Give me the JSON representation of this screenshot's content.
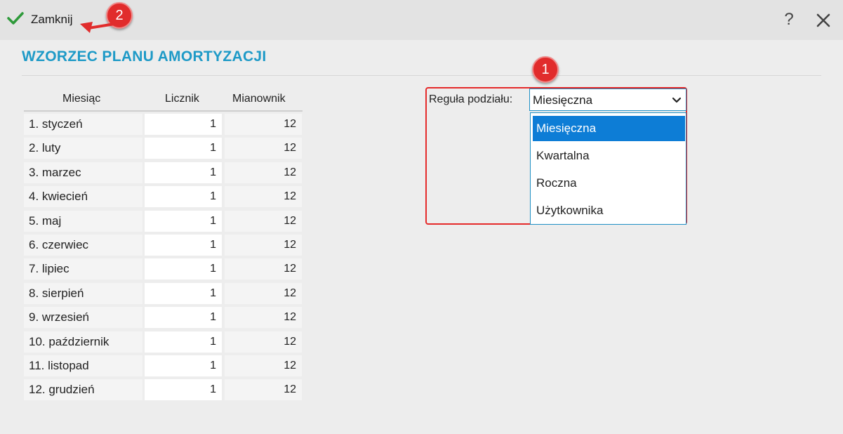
{
  "toolbar": {
    "close_label": "Zamknij",
    "help_label": "?"
  },
  "title": "WZORZEC PLANU AMORTYZACJI",
  "table": {
    "headers": [
      "Miesiąc",
      "Licznik",
      "Mianownik"
    ],
    "rows": [
      {
        "month": "1. styczeń",
        "licznik": "1",
        "mianownik": "12"
      },
      {
        "month": "2. luty",
        "licznik": "1",
        "mianownik": "12"
      },
      {
        "month": "3. marzec",
        "licznik": "1",
        "mianownik": "12"
      },
      {
        "month": "4. kwiecień",
        "licznik": "1",
        "mianownik": "12"
      },
      {
        "month": "5. maj",
        "licznik": "1",
        "mianownik": "12"
      },
      {
        "month": "6. czerwiec",
        "licznik": "1",
        "mianownik": "12"
      },
      {
        "month": "7. lipiec",
        "licznik": "1",
        "mianownik": "12"
      },
      {
        "month": "8. sierpień",
        "licznik": "1",
        "mianownik": "12"
      },
      {
        "month": "9. wrzesień",
        "licznik": "1",
        "mianownik": "12"
      },
      {
        "month": "10. październik",
        "licznik": "1",
        "mianownik": "12"
      },
      {
        "month": "11. listopad",
        "licznik": "1",
        "mianownik": "12"
      },
      {
        "month": "12. grudzień",
        "licznik": "1",
        "mianownik": "12"
      }
    ]
  },
  "rule": {
    "label": "Reguła podziału:",
    "selected": "Miesięczna",
    "options": [
      "Miesięczna",
      "Kwartalna",
      "Roczna",
      "Użytkownika"
    ]
  },
  "annotations": {
    "badge1": "1",
    "badge2": "2"
  },
  "colors": {
    "accent": "#1e9ac7",
    "annotation_red": "#e12c2c",
    "selection_blue": "#0d7dd6",
    "check_green": "#2e9a3a"
  }
}
